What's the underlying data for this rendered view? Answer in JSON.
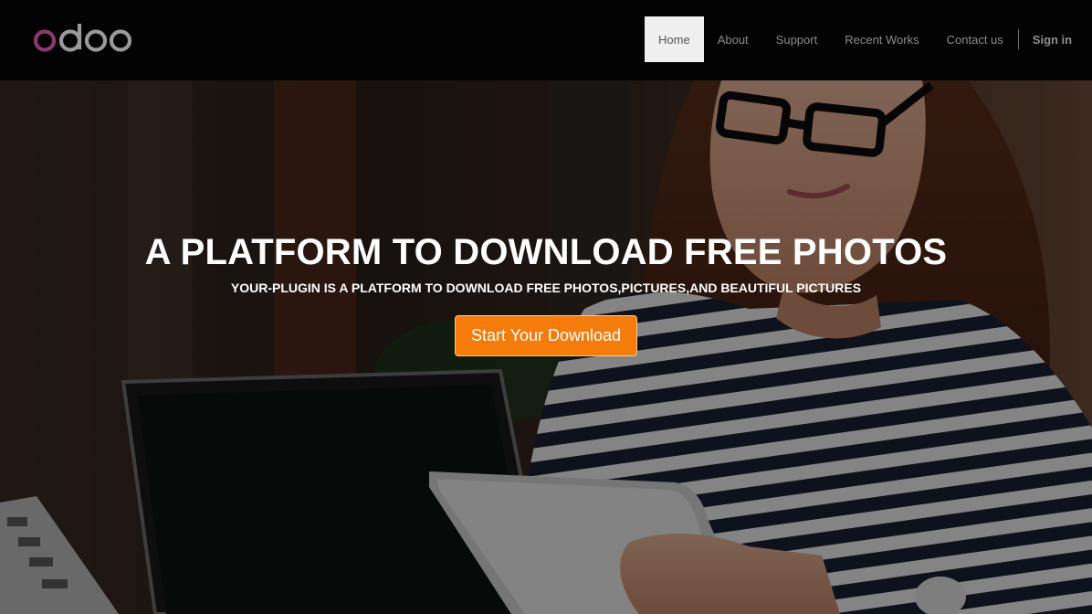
{
  "brand": {
    "logo_text": "odoo"
  },
  "nav": {
    "items": [
      {
        "label": "Home",
        "active": true
      },
      {
        "label": "About"
      },
      {
        "label": "Support"
      },
      {
        "label": "Recent Works"
      },
      {
        "label": "Contact us"
      }
    ],
    "signin_label": "Sign in"
  },
  "hero": {
    "title": "A PLATFORM TO DOWNLOAD FREE PHOTOS",
    "subtitle": "YOUR-PLUGIN IS A PLATFORM TO DOWNLOAD FREE PHOTOS,PICTURES,AND BEAUTIFUL PICTURES",
    "cta_label": "Start Your Download"
  },
  "colors": {
    "navbar_bg": "#030303",
    "active_tab_bg": "#efefef",
    "cta_bg": "#f57c0a",
    "logo_purple": "#8c3a6e",
    "logo_gray": "#9a9a9a"
  }
}
